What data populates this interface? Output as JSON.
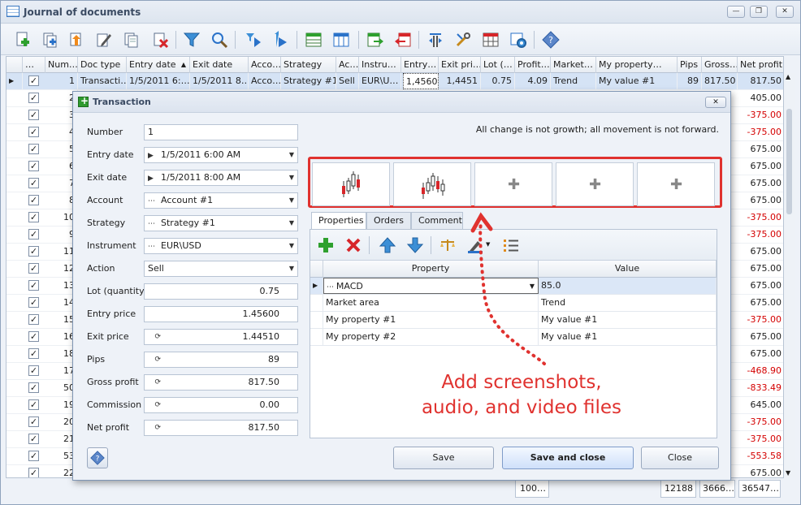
{
  "window": {
    "title": "Journal of documents",
    "buttons": [
      "—",
      "❐",
      "✕"
    ]
  },
  "toolbar": {
    "icons": [
      "add-document-icon",
      "add-copy-icon",
      "import-icon",
      "edit-icon",
      "copy-document-icon",
      "delete-icon",
      "filter-icon",
      "search-icon",
      "sort-down-icon",
      "sort-up-icon",
      "grid-layout-icon",
      "grid-columns-icon",
      "export-icon",
      "import-back-icon",
      "split-columns-icon",
      "tools-icon",
      "table-icon",
      "settings-icon",
      "help-icon"
    ]
  },
  "grid": {
    "headers": [
      "…",
      "Num…",
      "Doc type",
      "Entry date",
      "Exit date",
      "Acco…",
      "Strategy",
      "Ac…",
      "Instru…",
      "Entry…",
      "Exit pri…",
      "Lot (…",
      "Profit…",
      "Market…",
      "My property…",
      "Pips",
      "Gross…",
      "Net profit"
    ],
    "first_row": {
      "num": "1",
      "doc_type": "Transacti…",
      "entry_date": "1/5/2011 6:…",
      "exit_date": "1/5/2011 8…",
      "account": "Acco…",
      "strategy": "Strategy #1",
      "action": "Sell",
      "instrument": "EUR\\U…",
      "entry_price": "1,4560",
      "exit_price": "1,4451",
      "lot": "0.75",
      "profit": "4.09",
      "market": "Trend",
      "my_property": "My value #1",
      "pips": "89",
      "gross": "817.50",
      "net": "817.50"
    },
    "rows": [
      {
        "num": "2",
        "net": "405.00",
        "neg": false
      },
      {
        "num": "3",
        "net": "-375.00",
        "neg": true
      },
      {
        "num": "4",
        "net": "-375.00",
        "neg": true
      },
      {
        "num": "5",
        "net": "675.00",
        "neg": false
      },
      {
        "num": "6",
        "net": "675.00",
        "neg": false
      },
      {
        "num": "7",
        "net": "675.00",
        "neg": false
      },
      {
        "num": "8",
        "net": "675.00",
        "neg": false
      },
      {
        "num": "10",
        "net": "-375.00",
        "neg": true
      },
      {
        "num": "9",
        "net": "-375.00",
        "neg": true
      },
      {
        "num": "11",
        "net": "675.00",
        "neg": false
      },
      {
        "num": "12",
        "net": "675.00",
        "neg": false
      },
      {
        "num": "13",
        "net": "675.00",
        "neg": false
      },
      {
        "num": "14",
        "net": "675.00",
        "neg": false
      },
      {
        "num": "15",
        "net": "-375.00",
        "neg": true
      },
      {
        "num": "16",
        "net": "675.00",
        "neg": false
      },
      {
        "num": "18",
        "net": "675.00",
        "neg": false
      },
      {
        "num": "17",
        "net": "-468.90",
        "neg": true
      },
      {
        "num": "50",
        "net": "-833.49",
        "neg": true
      },
      {
        "num": "19",
        "net": "645.00",
        "neg": false
      },
      {
        "num": "20",
        "net": "-375.00",
        "neg": true
      },
      {
        "num": "21",
        "net": "-375.00",
        "neg": true
      },
      {
        "num": "53",
        "net": "-553.58",
        "neg": true
      },
      {
        "num": "22",
        "net": "675.00",
        "neg": false
      }
    ],
    "footer": {
      "lot_sum": "100…",
      "pips_sum": "12188",
      "gross_sum": "3666…",
      "net_sum": "36547…"
    }
  },
  "dialog": {
    "title": "Transaction",
    "quote": "All change is not growth; all movement is not forward.",
    "fields": [
      {
        "label": "Number",
        "value": "1",
        "kind": "text"
      },
      {
        "label": "Entry date",
        "value": "1/5/2011 6:00 AM",
        "kind": "date"
      },
      {
        "label": "Exit date",
        "value": "1/5/2011 8:00 AM",
        "kind": "date"
      },
      {
        "label": "Account",
        "value": "Account #1",
        "kind": "lookup"
      },
      {
        "label": "Strategy",
        "value": "Strategy #1",
        "kind": "lookup"
      },
      {
        "label": "Instrument",
        "value": "EUR\\USD",
        "kind": "lookup"
      },
      {
        "label": "Action",
        "value": "Sell",
        "kind": "select"
      },
      {
        "label": "Lot (quantity)",
        "value": "0.75",
        "kind": "spin"
      },
      {
        "label": "Entry price",
        "value": "1.45600",
        "kind": "number"
      },
      {
        "label": "Exit price",
        "value": "1.44510",
        "kind": "calc"
      },
      {
        "label": "Pips",
        "value": "89",
        "kind": "calc"
      },
      {
        "label": "Gross profit",
        "value": "817.50",
        "kind": "calc"
      },
      {
        "label": "Commission",
        "value": "0.00",
        "kind": "calc"
      },
      {
        "label": "Net profit",
        "value": "817.50",
        "kind": "calc"
      }
    ],
    "tabs": [
      "Properties",
      "Orders",
      "Comment"
    ],
    "active_tab": "Properties",
    "properties": {
      "headers": [
        "Property",
        "Value"
      ],
      "rows": [
        {
          "property": "MACD",
          "value": "85.0"
        },
        {
          "property": "Market area",
          "value": "Trend"
        },
        {
          "property": "My property #1",
          "value": "My value #1"
        },
        {
          "property": "My property #2",
          "value": "My value #1"
        }
      ]
    },
    "buttons": {
      "save": "Save",
      "save_close": "Save and close",
      "close": "Close"
    }
  },
  "annotation": {
    "line1": "Add screenshots,",
    "line2": "audio, and video files"
  },
  "colors": {
    "accent": "#e0322f",
    "negative": "#d40000",
    "selection": "#d5e3f5"
  }
}
